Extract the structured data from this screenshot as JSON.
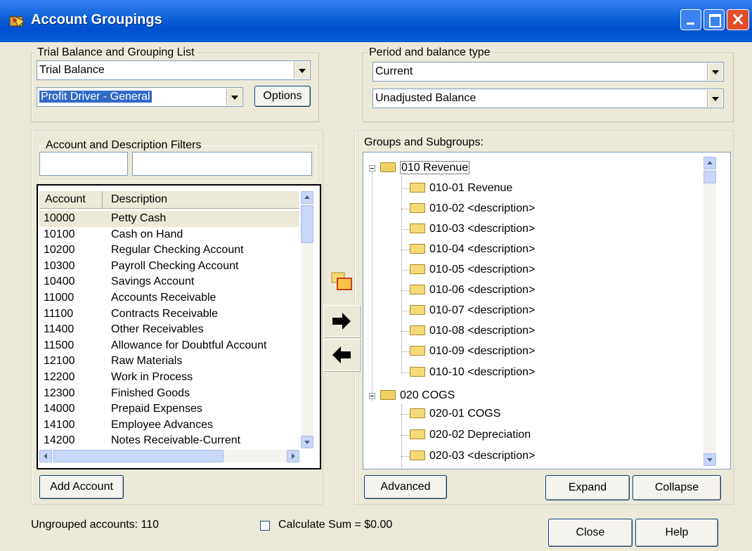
{
  "window": {
    "title": "Account Groupings",
    "icon": "app-icon"
  },
  "trial_balance": {
    "legend": "Trial Balance and Grouping List",
    "list_value": "Trial Balance",
    "grouping_value": "Profit Driver  - General",
    "options_label": "Options"
  },
  "period": {
    "legend": "Period and balance type",
    "period_value": "Current",
    "balance_value": "Unadjusted Balance"
  },
  "filters": {
    "legend": "Account and Description Filters",
    "account_filter": "",
    "description_filter": ""
  },
  "accounts": {
    "columns": [
      "Account",
      "Description"
    ],
    "rows": [
      {
        "account": "10000",
        "description": "Petty Cash"
      },
      {
        "account": "10100",
        "description": "Cash on Hand"
      },
      {
        "account": "10200",
        "description": "Regular Checking Account"
      },
      {
        "account": "10300",
        "description": "Payroll Checking Account"
      },
      {
        "account": "10400",
        "description": "Savings Account"
      },
      {
        "account": "11000",
        "description": "Accounts Receivable"
      },
      {
        "account": "11100",
        "description": "Contracts Receivable"
      },
      {
        "account": "11400",
        "description": "Other Receivables"
      },
      {
        "account": "11500",
        "description": "Allowance for Doubtful Account"
      },
      {
        "account": "12100",
        "description": "Raw Materials"
      },
      {
        "account": "12200",
        "description": "Work in Process"
      },
      {
        "account": "12300",
        "description": "Finished Goods"
      },
      {
        "account": "14000",
        "description": "Prepaid Expenses"
      },
      {
        "account": "14100",
        "description": "Employee Advances"
      },
      {
        "account": "14200",
        "description": "Notes Receivable-Current"
      }
    ],
    "add_label": "Add Account"
  },
  "groups": {
    "label": "Groups and Subgroups:",
    "tree": [
      {
        "label": "010  Revenue",
        "children": [
          "010-01  Revenue",
          "010-02  <description>",
          "010-03  <description>",
          "010-04  <description>",
          "010-05  <description>",
          "010-06  <description>",
          "010-07  <description>",
          "010-08  <description>",
          "010-09  <description>",
          "010-10  <description>"
        ]
      },
      {
        "label": "020  COGS",
        "children": [
          "020-01  COGS",
          "020-02  Depreciation",
          "020-03  <description>"
        ]
      }
    ],
    "advanced_label": "Advanced",
    "expand_label": "Expand",
    "collapse_label": "Collapse"
  },
  "footer": {
    "ungrouped": "Ungrouped accounts: 110",
    "calc_sum": "Calculate Sum = $0.00",
    "calc_checked": false,
    "close_label": "Close",
    "help_label": "Help"
  }
}
